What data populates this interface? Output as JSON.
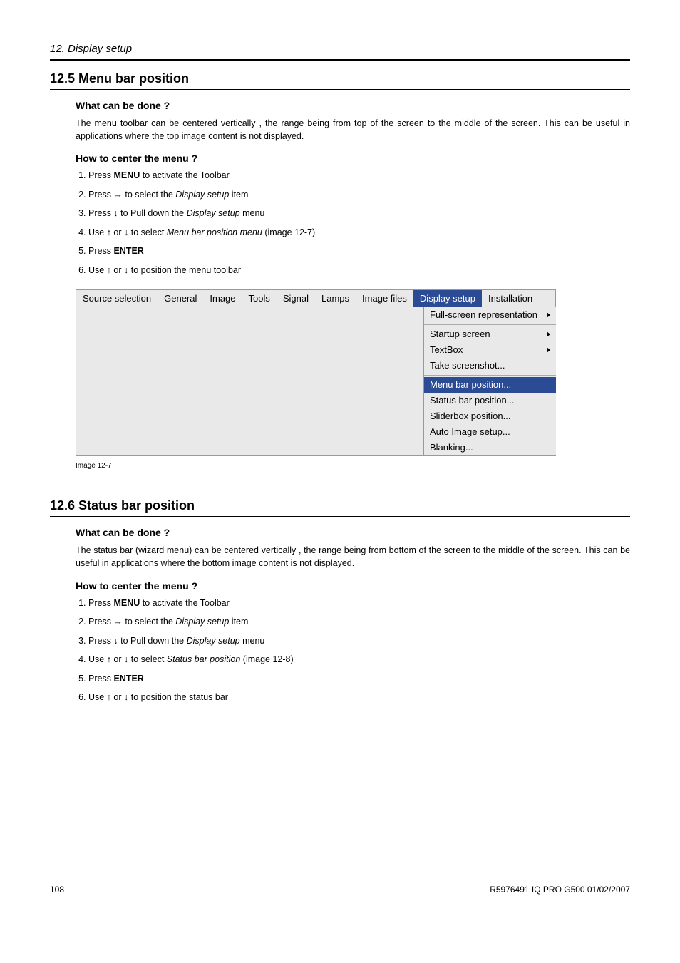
{
  "chapter": "12.  Display setup",
  "section_12_5": {
    "title": "12.5  Menu bar position",
    "what_heading": "What can be done ?",
    "what_text": "The menu toolbar can be centered vertically , the range being from top of the screen to the middle of the screen.  This can be useful in applications where the top image content is not displayed.",
    "how_heading": "How to center the menu ?",
    "steps": [
      {
        "pre": "Press ",
        "bold": "MENU",
        "post": " to activate the Toolbar"
      },
      {
        "pre": "Press → to select the ",
        "italic": "Display setup",
        "post": " item"
      },
      {
        "pre": "Press ↓ to Pull down the ",
        "italic": "Display setup",
        "post": " menu"
      },
      {
        "pre": "Use ↑ or ↓ to select ",
        "italic": "Menu bar position menu",
        "post": " (image 12-7)"
      },
      {
        "pre": "Press ",
        "bold": "ENTER",
        "post": ""
      },
      {
        "pre": "Use ↑ or ↓ to position the menu toolbar",
        "post": ""
      }
    ],
    "image_caption": "Image 12-7"
  },
  "menu_figure": {
    "menubar": [
      "Source selection",
      "General",
      "Image",
      "Tools",
      "Signal",
      "Lamps",
      "Image files",
      "Display setup",
      "Installation"
    ],
    "active_index": 7,
    "dropdown": [
      {
        "label": "Full-screen representation",
        "arrow": true,
        "hr": true
      },
      {
        "label": "Startup screen",
        "arrow": true
      },
      {
        "label": "TextBox",
        "arrow": true
      },
      {
        "label": "Take screenshot...",
        "hr": true
      },
      {
        "label": "Menu bar position...",
        "highlight": true
      },
      {
        "label": "Status bar position..."
      },
      {
        "label": "Sliderbox position..."
      },
      {
        "label": "Auto Image setup..."
      },
      {
        "label": "Blanking..."
      }
    ]
  },
  "section_12_6": {
    "title": "12.6  Status bar position",
    "what_heading": "What can be done ?",
    "what_text": "The status bar (wizard menu) can be centered vertically , the range being from bottom of the screen to the middle of the screen. This can be useful in applications where the bottom image content is not displayed.",
    "how_heading": "How to center the menu ?",
    "steps": [
      {
        "pre": "Press ",
        "bold": "MENU",
        "post": " to activate the Toolbar"
      },
      {
        "pre": "Press → to select the ",
        "italic": "Display setup",
        "post": " item"
      },
      {
        "pre": "Press ↓ to Pull down the ",
        "italic": "Display setup",
        "post": " menu"
      },
      {
        "pre": "Use ↑ or ↓ to select ",
        "italic": "Status bar position",
        "post": " (image 12-8)"
      },
      {
        "pre": "Press ",
        "bold": "ENTER",
        "post": ""
      },
      {
        "pre": "Use ↑ or ↓ to position the status bar",
        "post": ""
      }
    ]
  },
  "footer": {
    "page": "108",
    "doc": "R5976491  IQ PRO G500  01/02/2007"
  }
}
